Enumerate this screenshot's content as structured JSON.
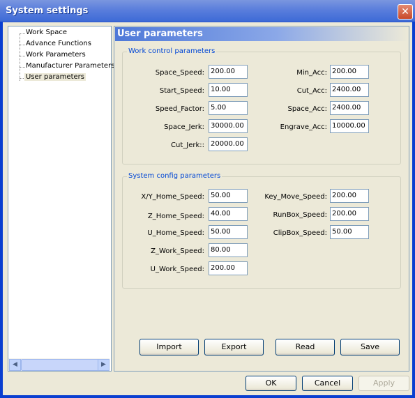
{
  "window": {
    "title": "System settings",
    "close_glyph": "✕"
  },
  "tree": {
    "items": [
      {
        "label": "Work Space"
      },
      {
        "label": "Advance Functions"
      },
      {
        "label": "Work Parameters"
      },
      {
        "label": "Manufacturer Parameters"
      },
      {
        "label": "User parameters",
        "selected": true
      }
    ],
    "scroll_left_glyph": "◀",
    "scroll_right_glyph": "▶"
  },
  "panel": {
    "title": "User parameters",
    "work_control": {
      "legend": "Work control parameters",
      "fields": [
        {
          "label": "Space_Speed:",
          "value": "200.00"
        },
        {
          "label": "Start_Speed:",
          "value": "10.00"
        },
        {
          "label": "Speed_Factor:",
          "value": "5.00"
        },
        {
          "label": "Space_Jerk:",
          "value": "30000.00"
        },
        {
          "label": "Cut_Jerk::",
          "value": "20000.00"
        },
        {
          "label": "Min_Acc:",
          "value": "200.00"
        },
        {
          "label": "Cut_Acc:",
          "value": "2400.00"
        },
        {
          "label": "Space_Acc:",
          "value": "2400.00"
        },
        {
          "label": "Engrave_Acc:",
          "value": "10000.00"
        }
      ]
    },
    "system_config": {
      "legend": "System config parameters",
      "fields": [
        {
          "label": "X/Y_Home_Speed:",
          "value": "50.00"
        },
        {
          "label": "Z_Home_Speed:",
          "value": "40.00"
        },
        {
          "label": "U_Home_Speed:",
          "value": "50.00"
        },
        {
          "label": "Z_Work_Speed:",
          "value": "80.00"
        },
        {
          "label": "U_Work_Speed:",
          "value": "200.00"
        },
        {
          "label": "Key_Move_Speed:",
          "value": "200.00"
        },
        {
          "label": "RunBox_Speed:",
          "value": "200.00"
        },
        {
          "label": "ClipBox_Speed:",
          "value": "50.00"
        }
      ]
    },
    "buttons": {
      "import": "Import",
      "export": "Export",
      "read": "Read",
      "save": "Save"
    }
  },
  "footer": {
    "ok": "OK",
    "cancel": "Cancel",
    "apply": "Apply"
  }
}
